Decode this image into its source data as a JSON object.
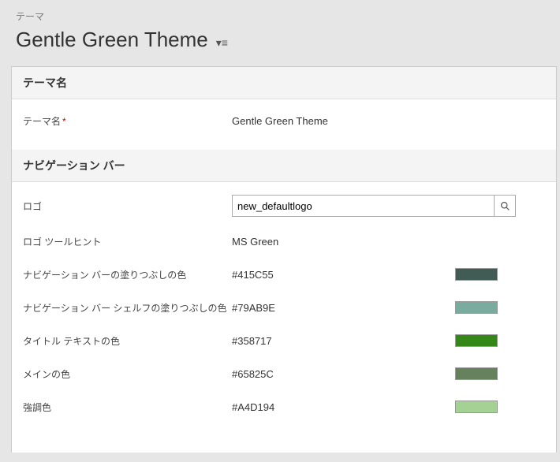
{
  "breadcrumb": "テーマ",
  "page_title": "Gentle Green Theme",
  "sections": {
    "theme_name": {
      "header": "テーマ名",
      "fields": {
        "name": {
          "label": "テーマ名",
          "value": "Gentle Green Theme",
          "required": true
        }
      }
    },
    "nav_bar": {
      "header": "ナビゲーション バー",
      "fields": {
        "logo": {
          "label": "ロゴ",
          "value": "new_defaultlogo"
        },
        "logo_tooltip": {
          "label": "ロゴ ツールヒント",
          "value": "MS Green"
        },
        "nav_fill": {
          "label": "ナビゲーション バーの塗りつぶしの色",
          "value": "#415C55",
          "color": "#415C55"
        },
        "nav_shelf_fill": {
          "label": "ナビゲーション バー シェルフの塗りつぶしの色",
          "value": "#79AB9E",
          "color": "#79AB9E"
        },
        "title_text_color": {
          "label": "タイトル テキストの色",
          "value": "#358717",
          "color": "#358717"
        },
        "main_color": {
          "label": "メインの色",
          "value": "#65825C",
          "color": "#65825C"
        },
        "accent_color": {
          "label": "強調色",
          "value": "#A4D194",
          "color": "#A4D194"
        }
      }
    }
  }
}
